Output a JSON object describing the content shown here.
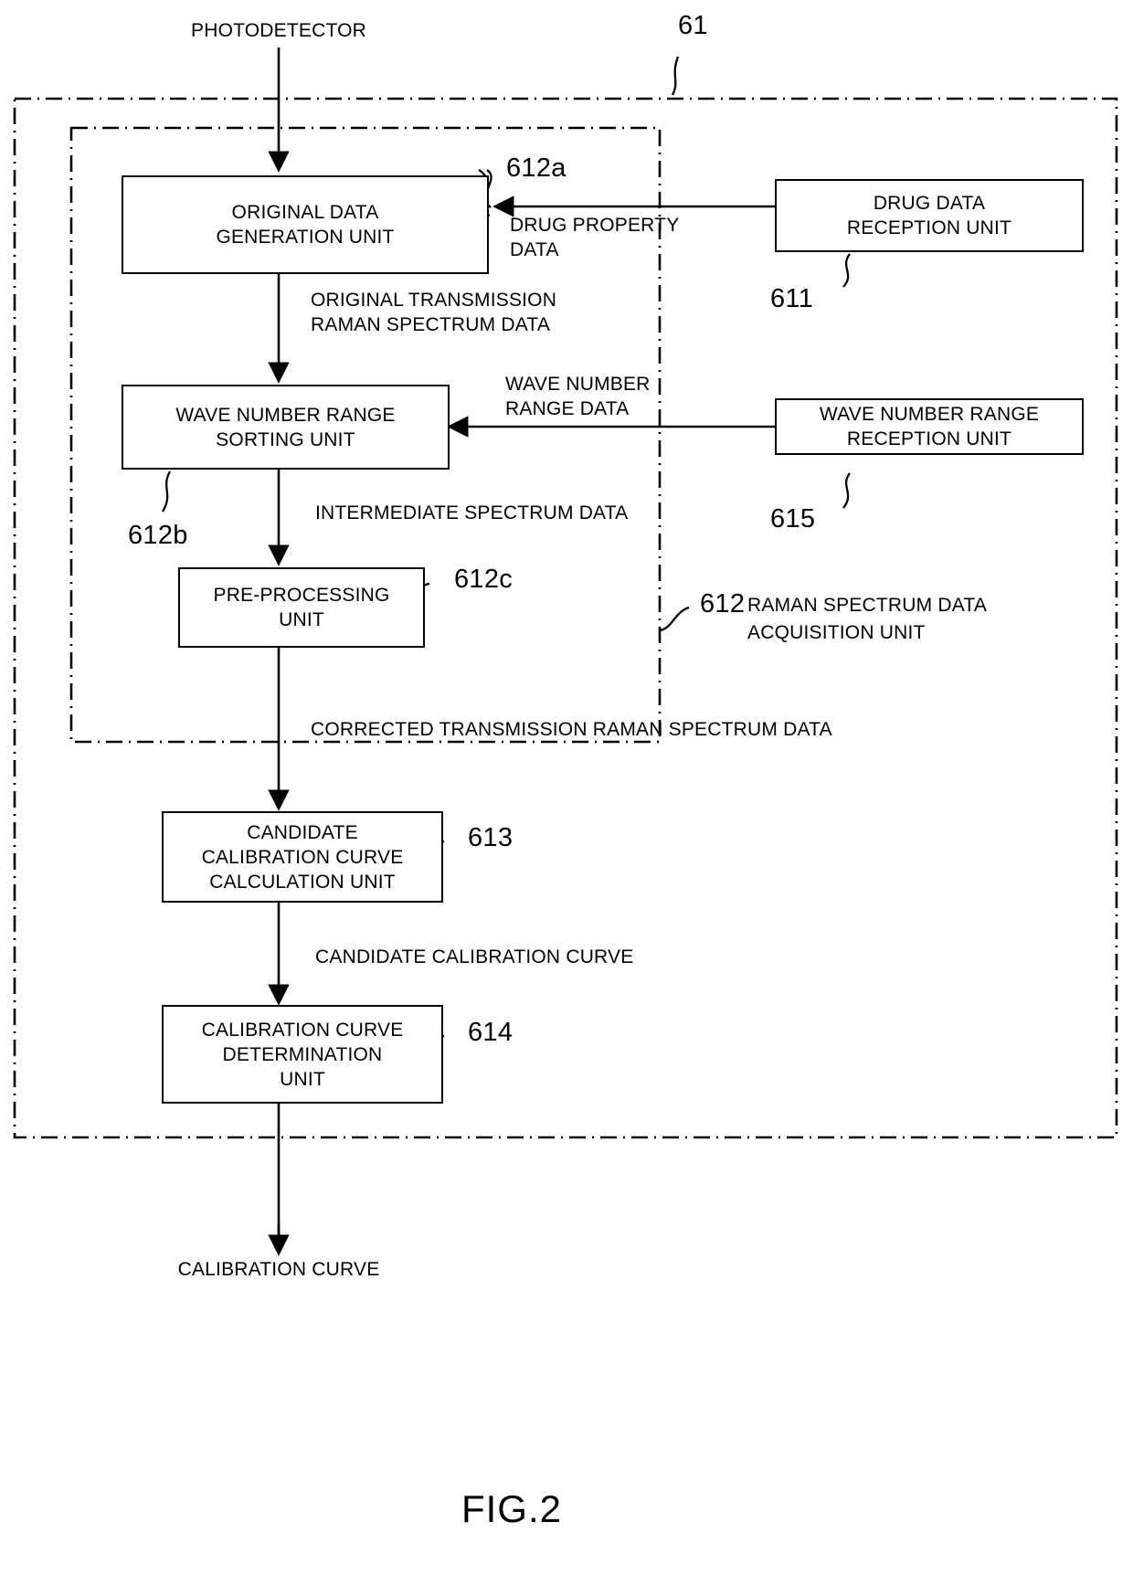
{
  "figure": {
    "label": "FIG.2",
    "top_reference": "61"
  },
  "io_labels": {
    "input": "PHOTODETECTOR",
    "output": "CALIBRATION CURVE"
  },
  "boxes": [
    {
      "id": "original-data-generation-unit",
      "label": "ORIGINAL DATA\nGENERATION UNIT",
      "ref": "612a"
    },
    {
      "id": "drug-data-reception-unit",
      "label": "DRUG DATA\nRECEPTION UNIT",
      "ref": "611"
    },
    {
      "id": "wave-number-range-sorting-unit",
      "label": "WAVE NUMBER RANGE\nSORTING UNIT",
      "ref": "612b"
    },
    {
      "id": "wave-number-range-reception-unit",
      "label": "WAVE NUMBER RANGE\nRECEPTION UNIT",
      "ref": "615"
    },
    {
      "id": "pre-processing-unit",
      "label": "PRE-PROCESSING\nUNIT",
      "ref": "612c"
    },
    {
      "id": "candidate-calibration-curve-calculation-unit",
      "label": "CANDIDATE\nCALIBRATION CURVE\nCALCULATION UNIT",
      "ref": "613"
    },
    {
      "id": "calibration-curve-determination-unit",
      "label": "CALIBRATION CURVE\nDETERMINATION\nUNIT",
      "ref": "614"
    }
  ],
  "flow_labels": {
    "drug_property_data": "DRUG PROPERTY\nDATA",
    "original_transmission": "ORIGINAL TRANSMISSION\nRAMAN SPECTRUM DATA",
    "wave_number_range_data": "WAVE NUMBER\nRANGE DATA",
    "intermediate_spectrum_data": "INTERMEDIATE SPECTRUM DATA",
    "corrected_transmission": "CORRECTED TRANSMISSION RAMAN SPECTRUM DATA",
    "candidate_calibration_curve": "CANDIDATE CALIBRATION CURVE"
  },
  "group_labels": {
    "acquisition_unit_ref": "612",
    "acquisition_unit_name": "RAMAN SPECTRUM DATA\nACQUISITION UNIT"
  },
  "colors": {
    "line": "#000000",
    "background": "#ffffff"
  }
}
